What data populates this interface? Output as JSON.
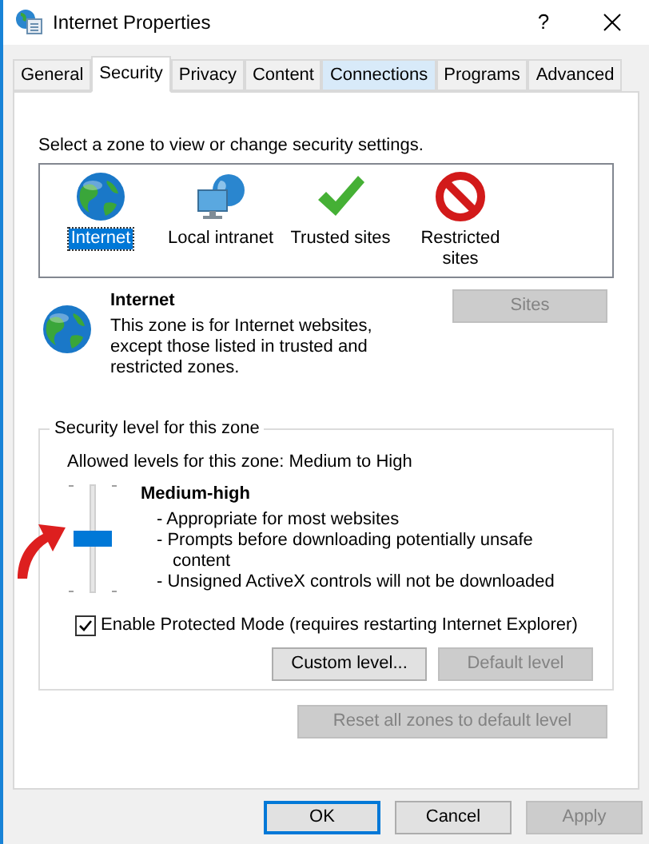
{
  "window": {
    "title": "Internet Properties",
    "help": "?"
  },
  "tabs": [
    {
      "label": "General",
      "selected": false,
      "hovered": false
    },
    {
      "label": "Security",
      "selected": true,
      "hovered": false
    },
    {
      "label": "Privacy",
      "selected": false,
      "hovered": false
    },
    {
      "label": "Content",
      "selected": false,
      "hovered": false
    },
    {
      "label": "Connections",
      "selected": false,
      "hovered": true
    },
    {
      "label": "Programs",
      "selected": false,
      "hovered": false
    },
    {
      "label": "Advanced",
      "selected": false,
      "hovered": false
    }
  ],
  "zone_prompt": "Select a zone to view or change security settings.",
  "zones": [
    {
      "kind": "globe",
      "label": "Internet",
      "selected": true
    },
    {
      "kind": "monitor",
      "label": "Local intranet",
      "selected": false
    },
    {
      "kind": "check",
      "label": "Trusted sites",
      "selected": false
    },
    {
      "kind": "forbidden",
      "label": "Restricted sites",
      "selected": false
    }
  ],
  "zone_info": {
    "kind": "globe",
    "title": "Internet",
    "description": "This zone is for Internet websites, except those listed in trusted and restricted zones.",
    "sites_button": {
      "label": "Sites",
      "disabled": true
    }
  },
  "security_level": {
    "legend": "Security level for this zone",
    "allowed": "Allowed levels for this zone: Medium to High",
    "level": 0.5,
    "level_name": "Medium-high",
    "bullets": [
      "- Appropriate for most websites",
      "- Prompts before downloading potentially unsafe content",
      "- Unsigned ActiveX controls will not be downloaded"
    ],
    "protected_mode": {
      "label": "Enable Protected Mode (requires restarting Internet Explorer)",
      "checked": true
    },
    "buttons": [
      {
        "label": "Custom level...",
        "disabled": false
      },
      {
        "label": "Default level",
        "disabled": true
      }
    ]
  },
  "reset_button": {
    "label": "Reset all zones to default level",
    "disabled": true
  },
  "dialog_buttons": [
    {
      "label": "OK",
      "disabled": false,
      "default": true
    },
    {
      "label": "Cancel",
      "disabled": false,
      "default": false
    },
    {
      "label": "Apply",
      "disabled": true,
      "default": false
    }
  ]
}
